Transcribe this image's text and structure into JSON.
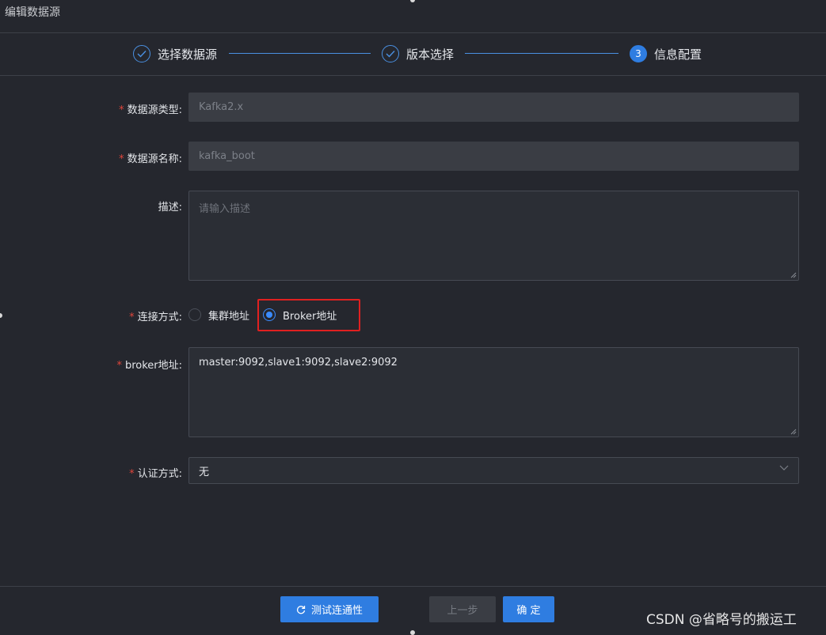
{
  "dialog": {
    "title": "编辑数据源"
  },
  "steps": [
    {
      "label": "选择数据源",
      "status": "done"
    },
    {
      "label": "版本选择",
      "status": "done"
    },
    {
      "label": "信息配置",
      "status": "active",
      "number": "3"
    }
  ],
  "form": {
    "type": {
      "label": "数据源类型:",
      "value": "Kafka2.x",
      "required": "*"
    },
    "name": {
      "label": "数据源名称:",
      "value": "kafka_boot",
      "required": "*"
    },
    "desc": {
      "label": "描述:",
      "placeholder": "请输入描述"
    },
    "connection": {
      "label": "连接方式:",
      "required": "*",
      "options": [
        "集群地址",
        "Broker地址"
      ],
      "selected": "Broker地址"
    },
    "broker": {
      "label": "broker地址:",
      "value": "master:9092,slave1:9092,slave2:9092",
      "required": "*"
    },
    "auth": {
      "label": "认证方式:",
      "value": "无",
      "required": "*"
    }
  },
  "footer": {
    "test_label": "测试连通性",
    "prev_label": "上一步",
    "ok_label": "确 定"
  },
  "watermark": "CSDN @省略号的搬运工",
  "colors": {
    "accent": "#2f7de1",
    "highlight": "#e02020",
    "background": "#25272e"
  }
}
